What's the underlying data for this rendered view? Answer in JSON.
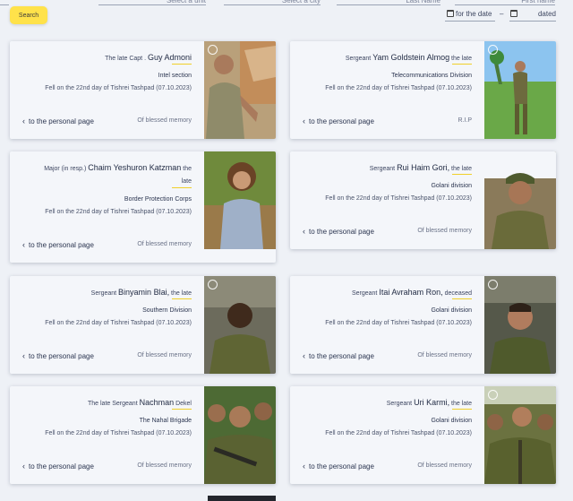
{
  "filters": {
    "unit_placeholder": "Select a unit",
    "city_placeholder": "Select a city",
    "last_name_placeholder": "Last Name",
    "first_name_placeholder": "First name",
    "search_label": "Search",
    "date_from_label": "for the date",
    "date_dash": "–",
    "date_to_label": "dated"
  },
  "cards": [
    {
      "prefix": "The late Capt .",
      "name": "Guy Admoni",
      "suffix": "",
      "unit": "Intel section",
      "fell": "Fell on the 22nd day of Tishrei Tashpad (07.10.2023)",
      "link": "to the personal page",
      "memory": "Of blessed memory"
    },
    {
      "prefix": "Sergeant",
      "name": "Yam Goldstein Almog",
      "suffix": "the late",
      "unit": "Telecommunications Division",
      "fell": "Fell on the 22nd day of Tishrei Tashpad (07.10.2023)",
      "link": "to the personal page",
      "memory": "R.I.P"
    },
    {
      "prefix": "Major (in resp.)",
      "name": "Chaim Yeshuron Katzman",
      "suffix": "the",
      "suffix2": "late",
      "unit": "Border Protection Corps",
      "fell": "Fell on the 22nd day of Tishrei Tashpad (07.10.2023)",
      "link": "to the personal page",
      "memory": "Of blessed memory"
    },
    {
      "prefix": "Sergeant",
      "name": "Rui Haim Gori,",
      "suffix": "the late",
      "unit": "Golani division",
      "fell": "Fell on the 22nd day of Tishrei Tashpad (07.10.2023)",
      "link": "to the personal page",
      "memory": "Of blessed memory"
    },
    {
      "prefix": "Sergeant",
      "name": "Binyamin Blai,",
      "suffix": "the late",
      "unit": "Southern Division",
      "fell": "Fell on the 22nd day of Tishrei Tashpad (07.10.2023)",
      "link": "to the personal page",
      "memory": "Of blessed memory"
    },
    {
      "prefix": "Sergeant",
      "name": "Itai Avraham Ron,",
      "suffix": "deceased",
      "unit": "Golani division",
      "fell": "Fell on the 22nd day of Tishrei Tashpad (07.10.2023)",
      "link": "to the personal page",
      "memory": "Of blessed memory"
    },
    {
      "prefix": "The late Sergeant",
      "name": "Nachman",
      "suffix": "Dekel",
      "unit": "The Nahal Brigade",
      "fell": "Fell on the 22nd day of Tishrei Tashpad (07.10.2023)",
      "link": "to the personal page",
      "memory": "Of blessed memory"
    },
    {
      "prefix": "Sergeant",
      "name": "Uri Karmi,",
      "suffix": "the late",
      "unit": "Golani division",
      "fell": "Fell on the 22nd day of Tishrei Tashpad (07.10.2023)",
      "link": "to the personal page",
      "memory": "Of blessed memory"
    }
  ],
  "colors": {
    "accent_yellow": "#ffe24a",
    "card_background": "#f4f6fa",
    "page_background": "#eef1f6",
    "text_dark": "#1f2942"
  }
}
